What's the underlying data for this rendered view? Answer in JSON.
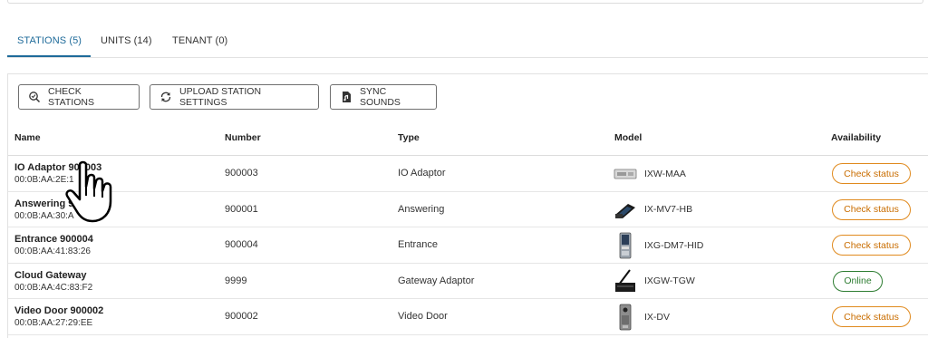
{
  "tabs": [
    {
      "label": "STATIONS (5)",
      "active": true
    },
    {
      "label": "UNITS (14)",
      "active": false
    },
    {
      "label": "TENANT (0)",
      "active": false
    }
  ],
  "toolbar": {
    "check_stations": "CHECK STATIONS",
    "upload_settings": "UPLOAD STATION SETTINGS",
    "sync_sounds": "SYNC SOUNDS"
  },
  "table": {
    "headers": {
      "name": "Name",
      "number": "Number",
      "type": "Type",
      "model": "Model",
      "availability": "Availability"
    },
    "rows": [
      {
        "name": "IO Adaptor 900003",
        "mac": "00:0B:AA:2E:1",
        "number": "900003",
        "type": "IO Adaptor",
        "model": "IXW-MAA",
        "model_icon": "io-adaptor-device-icon",
        "availability": "Check status",
        "status_kind": "check"
      },
      {
        "name": "Answering 90",
        "mac": "00:0B:AA:30:A",
        "number": "900001",
        "type": "Answering",
        "model": "IX-MV7-HB",
        "model_icon": "master-station-device-icon",
        "availability": "Check status",
        "status_kind": "check"
      },
      {
        "name": "Entrance 900004",
        "mac": "00:0B:AA:41:83:26",
        "number": "900004",
        "type": "Entrance",
        "model": "IXG-DM7-HID",
        "model_icon": "entrance-panel-device-icon",
        "availability": "Check status",
        "status_kind": "check"
      },
      {
        "name": "Cloud Gateway",
        "mac": "00:0B:AA:4C:83:F2",
        "number": "9999",
        "type": "Gateway Adaptor",
        "model": "IXGW-TGW",
        "model_icon": "gateway-device-icon",
        "availability": "Online",
        "status_kind": "online"
      },
      {
        "name": "Video Door 900002",
        "mac": "00:0B:AA:27:29:EE",
        "number": "900002",
        "type": "Video Door",
        "model": "IX-DV",
        "model_icon": "video-door-device-icon",
        "availability": "Check status",
        "status_kind": "check"
      }
    ]
  },
  "colors": {
    "accent": "#1f6b9a",
    "check_status": "#e08a1e",
    "online": "#2e7d32"
  }
}
